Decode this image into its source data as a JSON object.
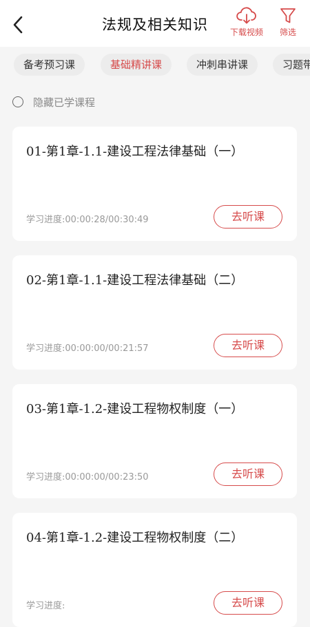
{
  "header": {
    "title": "法规及相关知识",
    "download_label": "下载视频",
    "filter_label": "筛选",
    "accent_color": "#d64a4a"
  },
  "tabs": [
    {
      "label": "备考预习课",
      "active": false
    },
    {
      "label": "基础精讲课",
      "active": true
    },
    {
      "label": "冲刺串讲课",
      "active": false
    },
    {
      "label": "习题带练",
      "active": false
    }
  ],
  "hide_learned": {
    "label": "隐藏已学课程",
    "checked": false
  },
  "courses": [
    {
      "title": "01-第1章-1.1-建设工程法律基础（一）",
      "progress_label": "学习进度:",
      "progress": "00:00:28/00:30:49",
      "button": "去听课"
    },
    {
      "title": "02-第1章-1.1-建设工程法律基础（二）",
      "progress_label": "学习进度:",
      "progress": "00:00:00/00:21:57",
      "button": "去听课"
    },
    {
      "title": "03-第1章-1.2-建设工程物权制度（一）",
      "progress_label": "学习进度:",
      "progress": "00:00:00/00:23:50",
      "button": "去听课"
    },
    {
      "title": "04-第1章-1.2-建设工程物权制度（二）",
      "progress_label": "学习进度:",
      "progress": "",
      "button": "去听课"
    }
  ]
}
